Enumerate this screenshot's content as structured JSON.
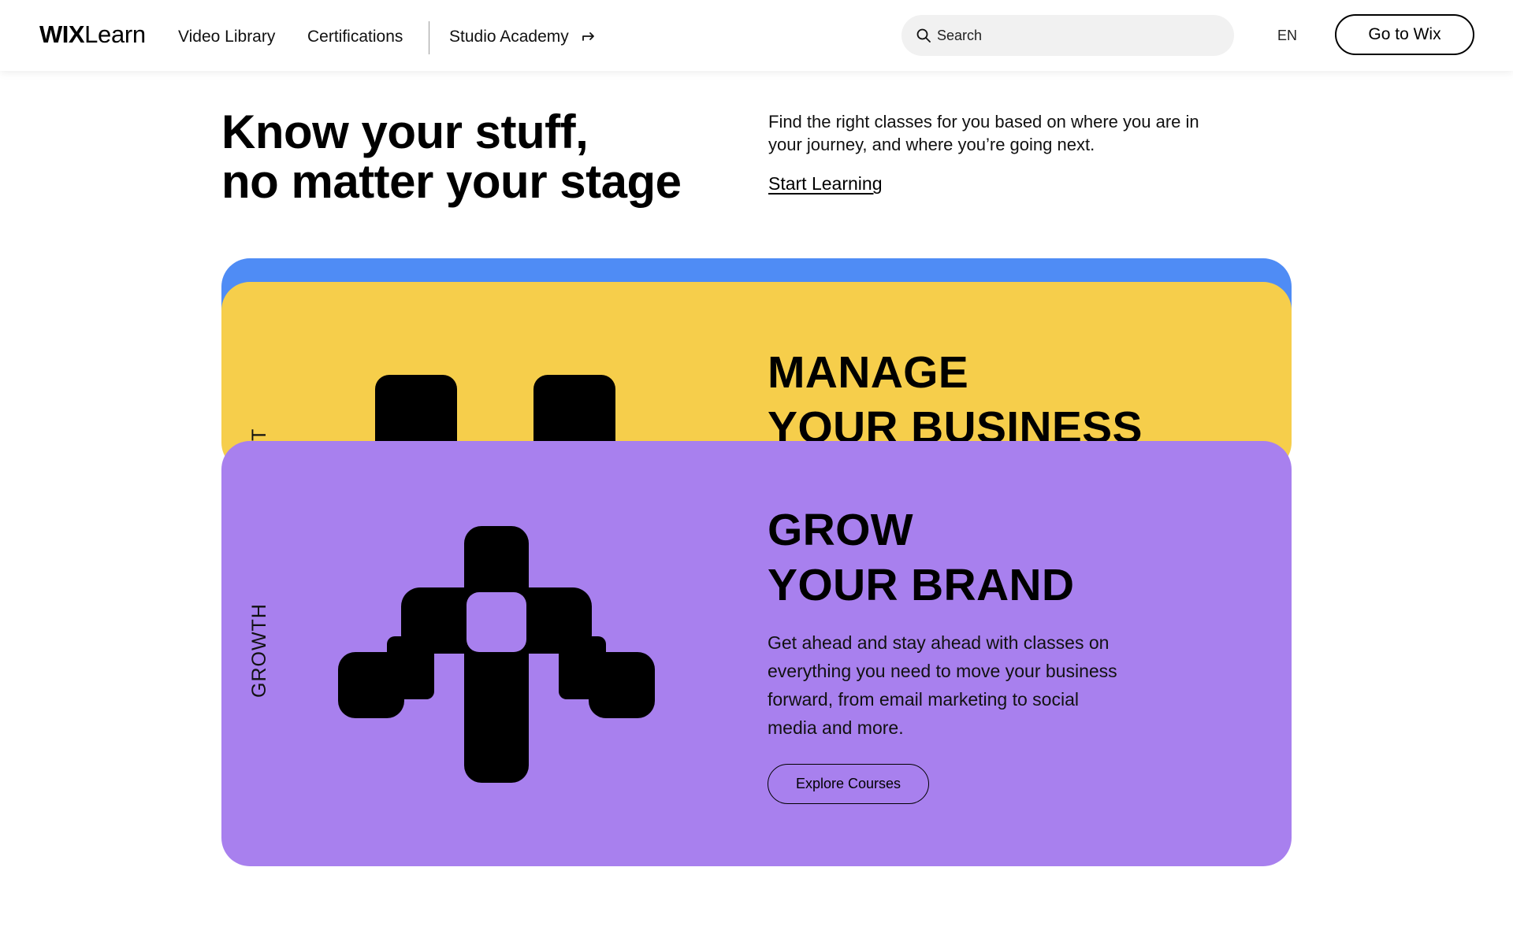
{
  "header": {
    "logo_wix": "WIX",
    "logo_learn": "Learn",
    "nav": {
      "video_library": "Video Library",
      "certifications": "Certifications",
      "studio_academy": "Studio Academy"
    },
    "search_placeholder": "Search",
    "language": "EN",
    "go_to_wix": "Go to Wix"
  },
  "hero": {
    "title_line1": "Know your stuff,",
    "title_line2": "no matter your stage",
    "description": "Find the right classes for you based on where you are in your journey, and where you’re going next.",
    "cta": "Start Learning"
  },
  "cards": {
    "blue": {
      "color": "#4f8cf5"
    },
    "yellow": {
      "color": "#f6ce4b",
      "vertical_label": "IT",
      "title_line1": "MANAGE",
      "title_line2": "YOUR BUSINESS"
    },
    "purple": {
      "color": "#a880ee",
      "vertical_label": "GROWTH",
      "title_line1": "GROW",
      "title_line2": "YOUR BRAND",
      "description": "Get ahead and stay ahead with classes on everything you need to move your business forward, from email marketing to social media and more.",
      "cta": "Explore Courses"
    }
  }
}
